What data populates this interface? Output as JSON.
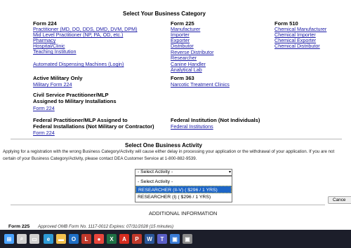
{
  "page": {
    "main_title": "Select Your Business Category",
    "col1": {
      "header": "Form 224",
      "links": [
        "Practitioner (MD, DO, DDS, DMD, DVM, DPM)",
        "Mid Level Practitioner (NP, PA, OD, etc.)",
        "Pharmacy",
        "Hospital/Clinic",
        "Teaching Institution"
      ],
      "automated_link": "Automated Dispensing Machines (Login)"
    },
    "col2": {
      "header": "Form 225",
      "links": [
        "Manufacturer",
        "Importer",
        "Exporter",
        "Distributor",
        "Reverse Distributor",
        "Researcher",
        "Canine Handler",
        "Analytical Lab"
      ],
      "form363_header": "Form 363",
      "form363_link": "Narcotic Treatment Clinics"
    },
    "col3": {
      "header": "Form 510",
      "links": [
        "Chemical Manufacturer",
        "Chemical Importer",
        "Chemical Exporter",
        "Chemical Distributor"
      ]
    },
    "military": {
      "header": "Active Military Only",
      "link": "Military Form 224"
    },
    "civil": {
      "header_line1": "Civil Service Practitioner/MLP",
      "header_line2": "Assigned to Military Installations",
      "link": "Form 224"
    },
    "federal_mlp": {
      "header_line1": "Federal Practitioner/MLP Assigned to",
      "header_line2": "Federal Installations (Not Military or Contractor)",
      "link": "Form 224"
    },
    "federal_institution": {
      "header": "Federal Institution (Not Individuals)",
      "link": "Federal Institutions"
    },
    "activity": {
      "title": "Select One Business Activity",
      "warning_line1": "Applying for a registration with the wrong Business Category/Activity will cause either delay in processing your application or the withdrawal of your application. If you are not",
      "warning_line2": "certain of your Business Category/Activity, please contact DEA Customer Service at 1-800-882-9539.",
      "select_value": "- Select Activity -",
      "options": [
        "- Select Activity -",
        "RESEARCHER (II-V) ( $296 / 1 YRS)",
        "RESEARCHER (I) ( $296 / 1 YRS)"
      ],
      "selected_index": 1,
      "cancel_label": "Cance"
    },
    "additional_info": "ADDITIONAL INFORMATION",
    "footer": {
      "form_label": "Form 225",
      "omb_text": "Approved OMB Form No. 1117-0012 Expires: 07/31/2028 (15 minutes)"
    }
  },
  "taskbar": {
    "items": [
      {
        "icon": "windows-start-icon",
        "glyph": "⊞",
        "color": "#4aa3ff"
      },
      {
        "icon": "search-icon",
        "glyph": "⌕",
        "color": "#d0d0d0"
      },
      {
        "icon": "task-view-icon",
        "glyph": "▭",
        "color": "#d0d0d0"
      },
      {
        "icon": "edge-icon",
        "glyph": "e",
        "color": "#2e9bd6"
      },
      {
        "icon": "file-explorer-icon",
        "glyph": "▬",
        "color": "#f2c14e"
      },
      {
        "icon": "outlook-icon",
        "glyph": "O",
        "color": "#1f6fc5"
      },
      {
        "icon": "app-l-icon",
        "glyph": "L",
        "color": "#c0392b"
      },
      {
        "icon": "chrome-icon",
        "glyph": "●",
        "color": "#e8453c"
      },
      {
        "icon": "excel-icon",
        "glyph": "X",
        "color": "#1e7145"
      },
      {
        "icon": "acrobat-icon",
        "glyph": "A",
        "color": "#d62d20"
      },
      {
        "icon": "pdf-icon",
        "glyph": "P",
        "color": "#c0392b"
      },
      {
        "icon": "word-icon",
        "glyph": "W",
        "color": "#2b579a"
      },
      {
        "icon": "teams-icon",
        "glyph": "T",
        "color": "#5b5fc7"
      },
      {
        "icon": "app-blue-icon",
        "glyph": "▣",
        "color": "#3a7bd5"
      },
      {
        "icon": "app-gray-icon",
        "glyph": "▣",
        "color": "#8a8a8a"
      }
    ]
  }
}
